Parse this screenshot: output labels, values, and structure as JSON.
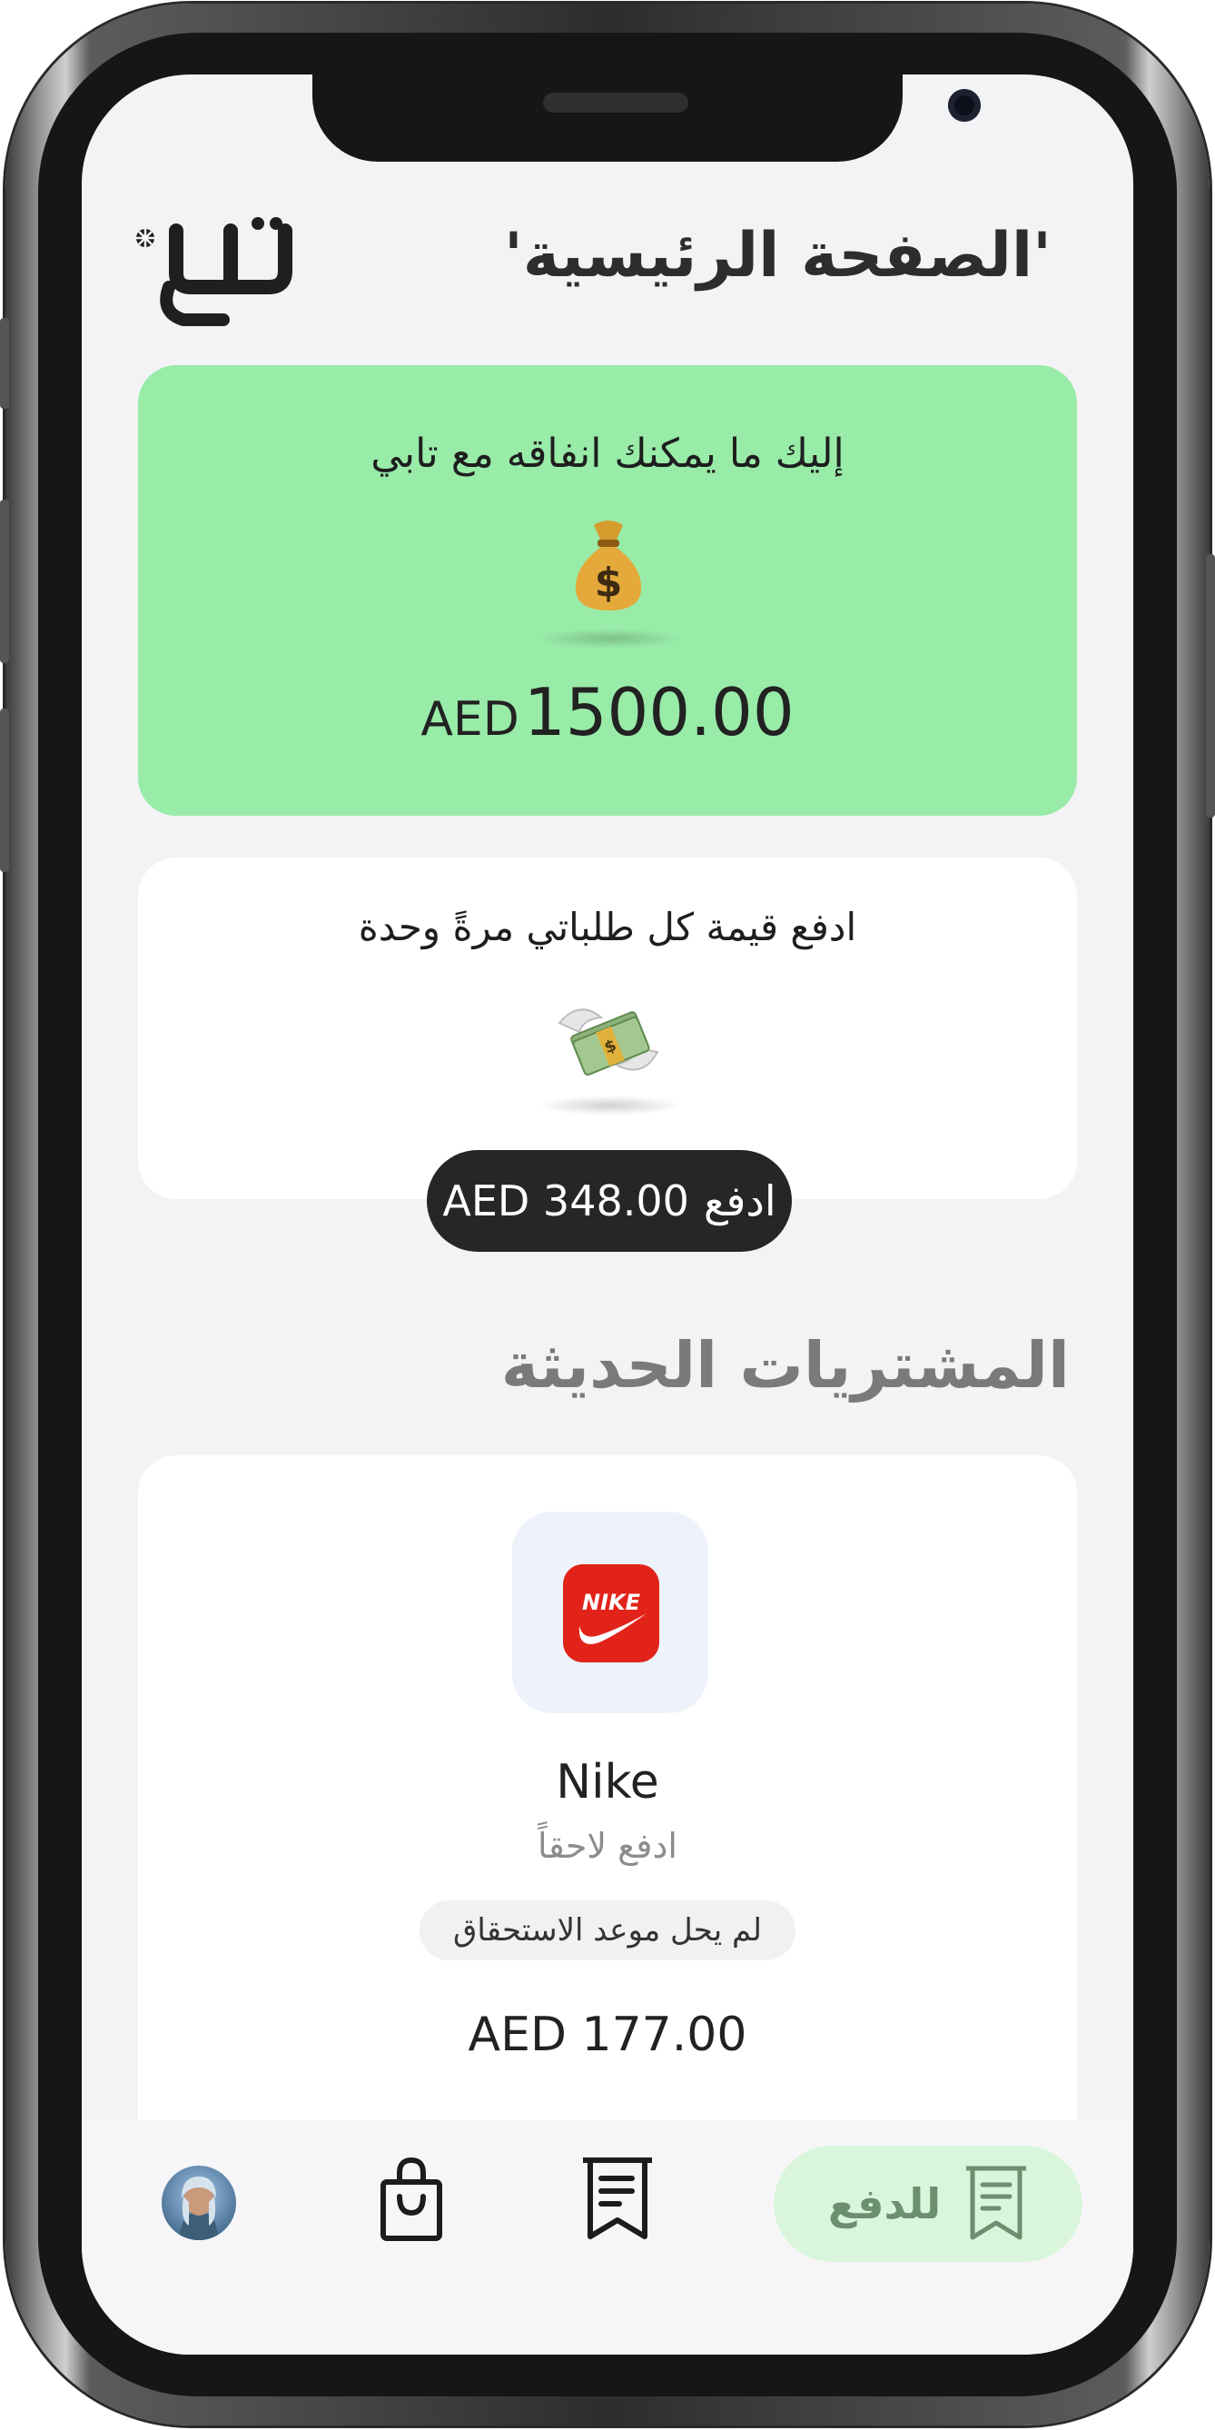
{
  "header": {
    "title": "'الصفحة الرئيسية'",
    "logo_text": "تابي"
  },
  "spend_card": {
    "heading": "إليك ما يمكنك انفاقه مع تابي",
    "icon": "money-bag-icon",
    "amount": "1500.00",
    "currency": "AED"
  },
  "pay_all_card": {
    "heading": "ادفع قيمة كل طلباتي مرةً وحدة",
    "icon": "money-with-wings-icon",
    "button_label": "ادفع",
    "button_amount": "AED 348.00"
  },
  "recent": {
    "title": "المشتريات الحديثة",
    "items": [
      {
        "merchant": "Nike",
        "logo": "nike-logo",
        "plan": "ادفع لاحقاً",
        "status": "لم يحل موعد الاستحقاق",
        "amount": "AED 177.00"
      }
    ]
  },
  "bottom_nav": {
    "profile": "avatar",
    "shop": "shopping-bag-icon",
    "orders": "receipt-icon",
    "pay_label": "للدفع",
    "pay_icon": "receipt-icon"
  },
  "colors": {
    "spend_card_bg": "#99eba8",
    "pay_pill_bg": "#262626",
    "pay_nav_bg": "#d9f6dc",
    "nike_red": "#e2231a",
    "screen_bg": "#f3f3f6"
  }
}
